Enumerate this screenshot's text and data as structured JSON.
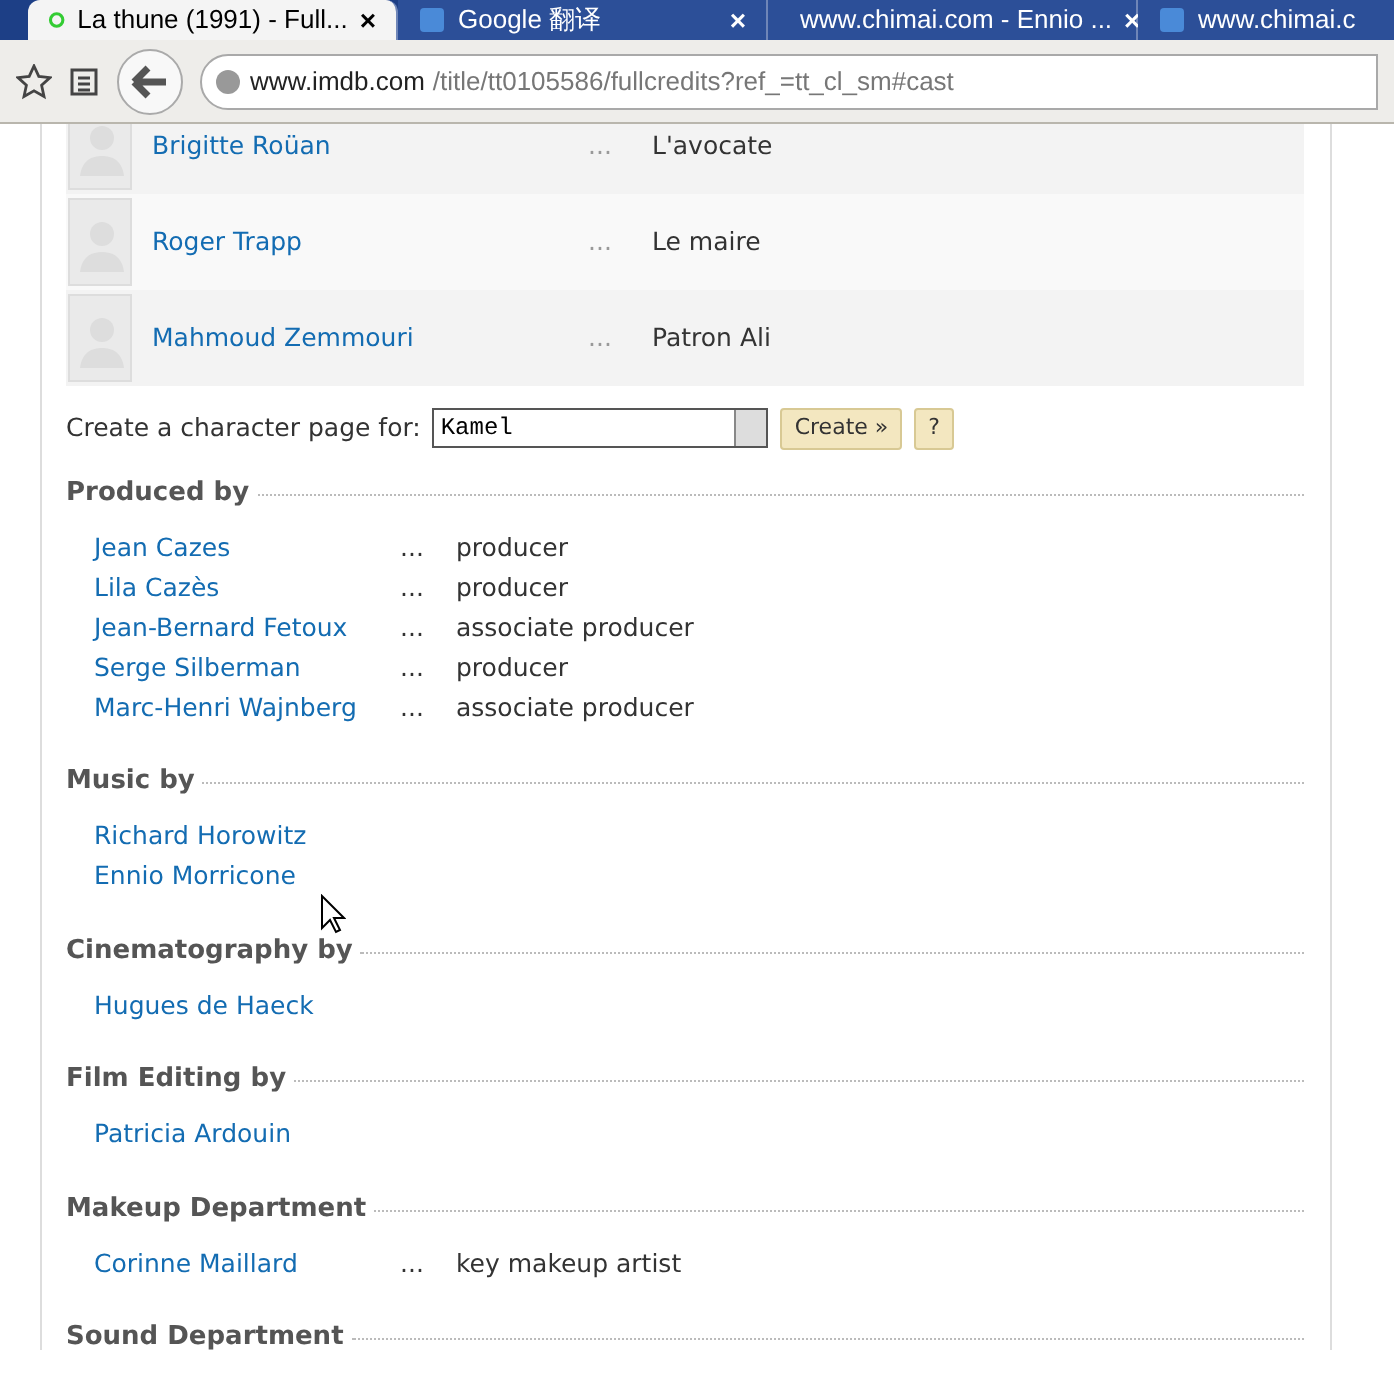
{
  "browser": {
    "tabs": [
      {
        "title": "La thune (1991) - Full...",
        "selected": true
      },
      {
        "title": "Google 翻译",
        "selected": false
      },
      {
        "title": "www.chimai.com - Ennio ...",
        "selected": false
      },
      {
        "title": "www.chimai.c",
        "selected": false
      }
    ],
    "close_glyph": "×",
    "address": {
      "host": "www.imdb.com",
      "path": "/title/tt0105586/fullcredits?ref_=tt_cl_sm#cast"
    }
  },
  "cast": [
    {
      "name": "Brigitte Roüan",
      "dots": "...",
      "character": "L'avocate"
    },
    {
      "name": "Roger Trapp",
      "dots": "...",
      "character": "Le maire"
    },
    {
      "name": "Mahmoud Zemmouri",
      "dots": "...",
      "character": "Patron Ali"
    }
  ],
  "character_page": {
    "label": "Create a character page for:",
    "value": "Kamel",
    "create_button": "Create »",
    "help_button": "?"
  },
  "sections": [
    {
      "title": "Produced by",
      "credits": [
        {
          "name": "Jean Cazes",
          "dots": "...",
          "role": "producer"
        },
        {
          "name": "Lila Cazès",
          "dots": "...",
          "role": "producer"
        },
        {
          "name": "Jean-Bernard Fetoux",
          "dots": "...",
          "role": "associate producer"
        },
        {
          "name": "Serge Silberman",
          "dots": "...",
          "role": "producer"
        },
        {
          "name": "Marc-Henri Wajnberg",
          "dots": "...",
          "role": "associate producer"
        }
      ]
    },
    {
      "title": "Music by",
      "credits": [
        {
          "name": "Richard Horowitz"
        },
        {
          "name": "Ennio Morricone"
        }
      ]
    },
    {
      "title": "Cinematography by",
      "credits": [
        {
          "name": "Hugues de Haeck"
        }
      ]
    },
    {
      "title": "Film Editing by",
      "credits": [
        {
          "name": "Patricia Ardouin"
        }
      ]
    },
    {
      "title": "Makeup Department",
      "credits": [
        {
          "name": "Corinne Maillard",
          "dots": "...",
          "role": "key makeup artist"
        }
      ]
    },
    {
      "title": "Sound Department"
    }
  ]
}
